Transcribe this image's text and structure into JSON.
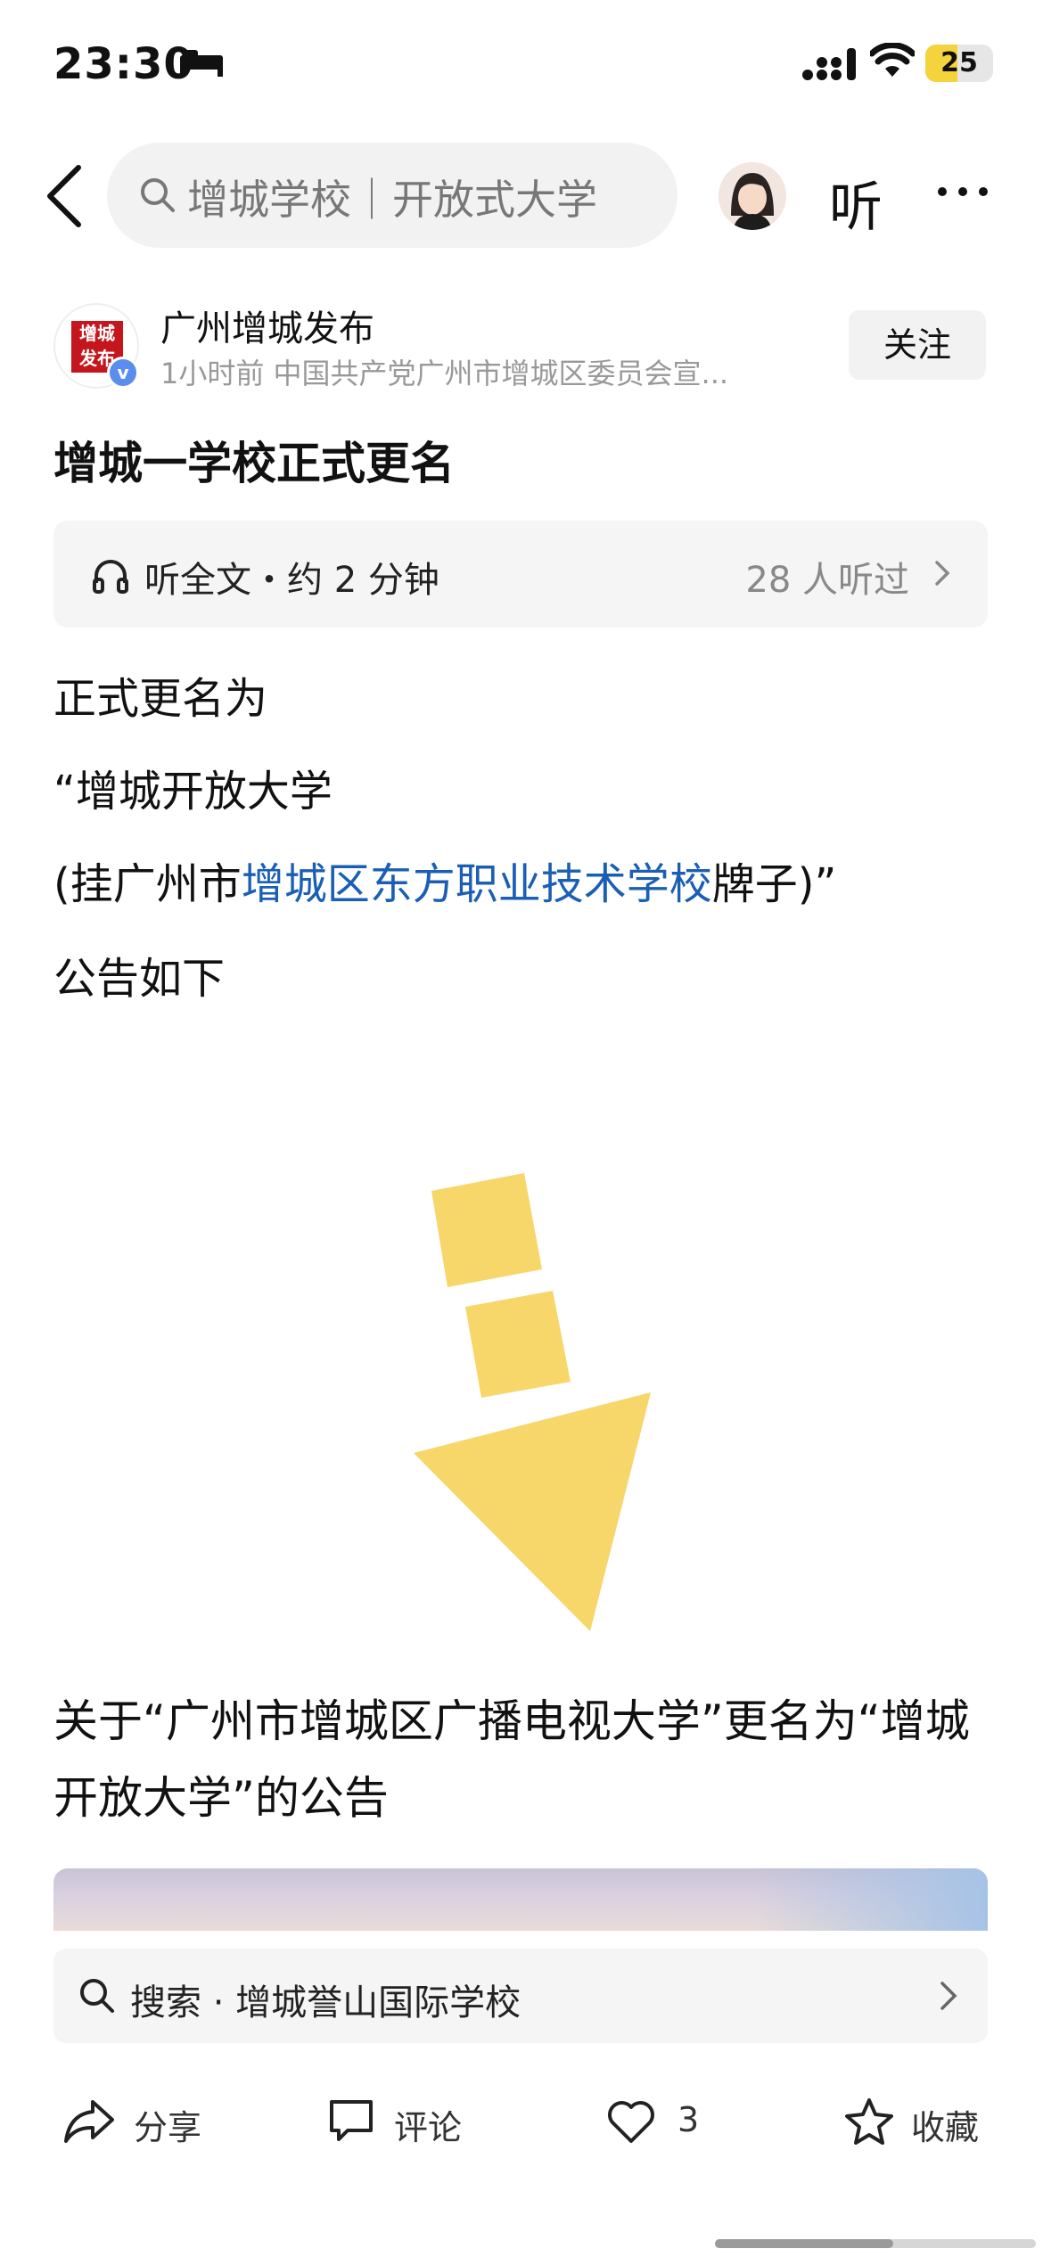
{
  "status_bar": {
    "time": "23:30",
    "battery": "25",
    "icons": [
      "bed-icon",
      "signal-icon",
      "wifi-icon",
      "battery-icon"
    ]
  },
  "nav": {
    "search_text": "增城学校｜开放式大学",
    "listen_label": "听",
    "icons": [
      "back-arrow-icon",
      "search-icon",
      "avatar",
      "more-icon"
    ]
  },
  "author": {
    "logo_text": "增城发布",
    "name": "广州增城发布",
    "meta": "1小时前  中国共产党广州市增城区委员会宣...",
    "verified_mark": "v",
    "follow_label": "关注"
  },
  "article": {
    "title": "增城一学校正式更名",
    "audio": {
      "label": "听全文・约 2 分钟",
      "count": "28 人听过"
    },
    "paragraphs": {
      "p1": "正式更名为",
      "p2": "“增城开放大学",
      "p3_before": "(挂广州市",
      "p3_link": "增城区东方职业技术学校",
      "p3_after": "牌子)”",
      "p4": "公告如下"
    },
    "announcement": "关于“广州市增城区广播电视大学”更名为“增城开放大学”的公告"
  },
  "search_suggestion": {
    "text": "搜索 · 增城誉山国际学校"
  },
  "actions": {
    "share": "分享",
    "comment": "评论",
    "like_count": "3",
    "favorite": "收藏"
  },
  "colors": {
    "link": "#1a5fb4",
    "arrow_yellow": "#f7d66a",
    "verified_blue": "#5b8def",
    "battery_yellow": "#f5d33c"
  }
}
